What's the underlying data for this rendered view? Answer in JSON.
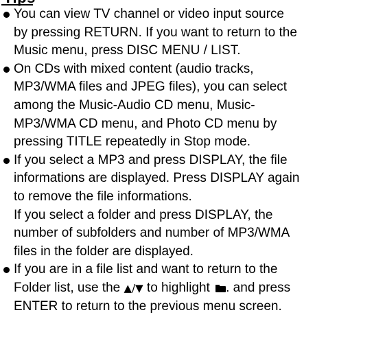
{
  "heading": "Tips",
  "tips": [
    {
      "lines": [
        "You can view TV channel or video input source",
        "by pressing RETURN. If you want to return to the",
        "Music menu, press DISC MENU / LIST."
      ]
    },
    {
      "lines": [
        "On CDs with mixed content (audio tracks,",
        "MP3/WMA files and JPEG files), you can select",
        "among the Music-Audio CD menu, Music-",
        "MP3/WMA CD menu, and Photo CD menu by",
        "pressing TITLE repeatedly in Stop mode."
      ]
    },
    {
      "lines": [
        "If you select a MP3 and press DISPLAY, the file",
        "informations are displayed. Press DISPLAY again",
        "to remove the file informations.",
        "If you select a folder and press DISPLAY, the",
        "number of subfolders and number of MP3/WMA",
        "files in the folder are displayed."
      ]
    },
    {
      "line1": "If you are in a file list and want to return to the",
      "line2_before_arrows": "Folder list, use the ",
      "arrows": "▲/▼",
      "line2_mid": " to highlight ",
      "folder_icon": "folder-icon",
      "line2_after": ". and press",
      "line3": "ENTER to return to the previous menu screen."
    }
  ]
}
